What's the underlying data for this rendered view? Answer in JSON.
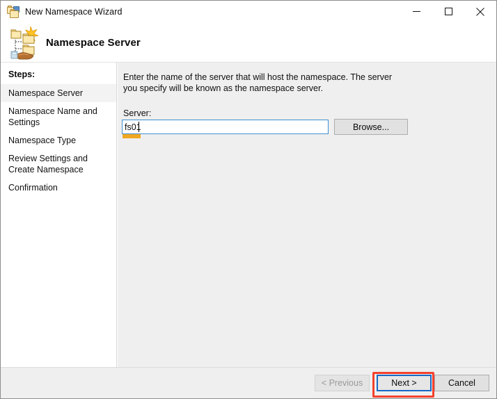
{
  "window": {
    "title": "New Namespace Wizard",
    "icon": "folders-icon",
    "controls": {
      "minimize": "minimize-icon",
      "maximize": "maximize-icon",
      "close": "close-icon"
    }
  },
  "header": {
    "title": "Namespace Server",
    "icon": "namespace-wizard-icon"
  },
  "steps": {
    "heading": "Steps:",
    "items": [
      {
        "label": "Namespace Server",
        "active": true
      },
      {
        "label": "Namespace Name and Settings",
        "active": false
      },
      {
        "label": "Namespace Type",
        "active": false
      },
      {
        "label": "Review Settings and Create Namespace",
        "active": false
      },
      {
        "label": "Confirmation",
        "active": false
      }
    ]
  },
  "main": {
    "instructions": "Enter the name of the server that will host the namespace. The server you specify will be known as the namespace server.",
    "server_label": "Server:",
    "server_value": "fs01",
    "server_placeholder": "",
    "browse_label": "Browse..."
  },
  "footer": {
    "previous_label": "< Previous",
    "next_label": "Next >",
    "cancel_label": "Cancel"
  },
  "annotations": {
    "highlight_color": "#f4412e",
    "underline_color": "#f0a722",
    "focus_color": "#1569c7"
  }
}
